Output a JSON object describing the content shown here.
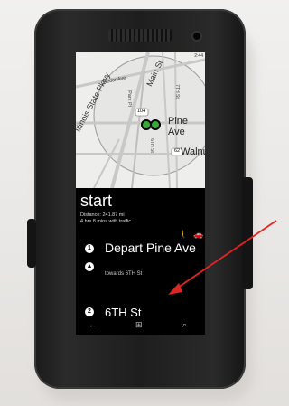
{
  "map": {
    "roads": [
      "Cedar Ave",
      "Main St",
      "Park Pl",
      "Pine Ave",
      "Walnut",
      "6TH St",
      "7TH St",
      "Illinois State Pkwy",
      "104",
      "62"
    ],
    "status_time": "2:44"
  },
  "route": {
    "title": "start",
    "distance": "Distance: 241.87 mi",
    "duration": "4 hrs 8 mins with traffic",
    "steps": [
      {
        "number": "1",
        "title": "Depart Pine Ave",
        "sub": "towards 6TH St"
      },
      {
        "number": "2",
        "title": "6TH St"
      }
    ]
  },
  "icons": {
    "walk": "walk-icon",
    "car": "car-icon",
    "back": "back-icon",
    "start": "windows-start-icon",
    "search": "search-icon"
  },
  "colors": {
    "arrow": "#e02424",
    "phone": "#1c1c1c"
  }
}
